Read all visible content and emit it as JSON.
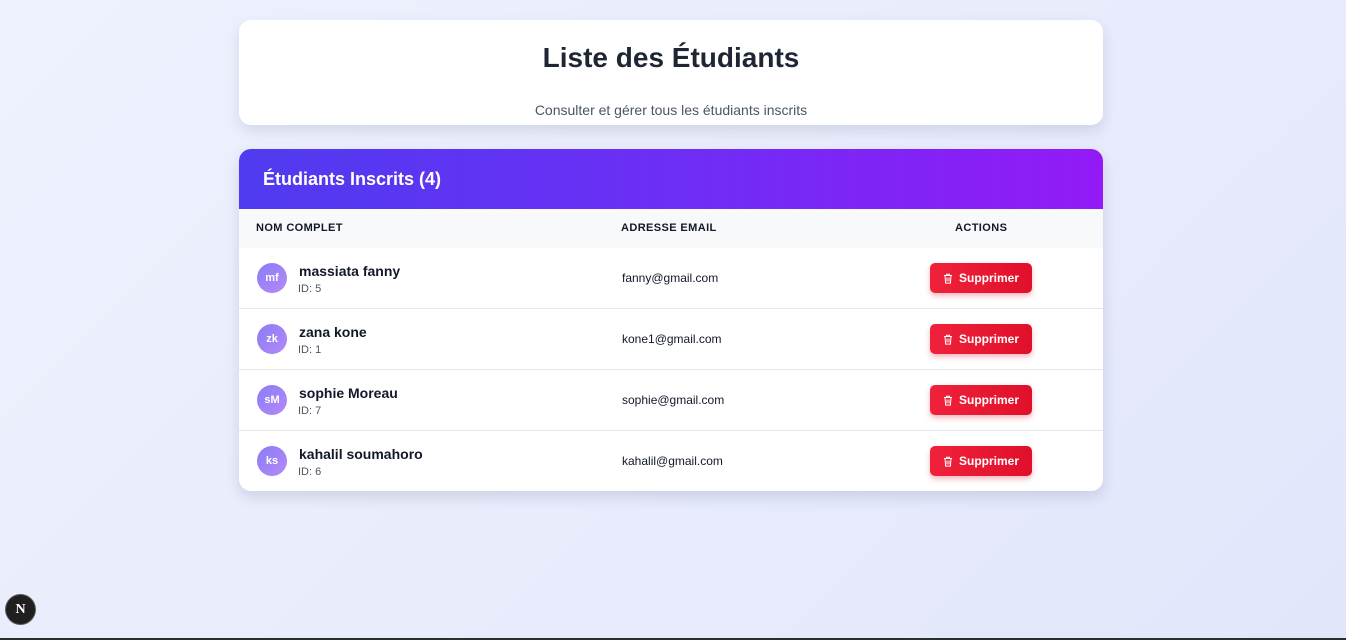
{
  "header": {
    "title": "Liste des Étudiants",
    "subtitle": "Consulter et gérer tous les étudiants inscrits"
  },
  "table": {
    "title": "Étudiants Inscrits (4)",
    "columns": {
      "name": "NOM COMPLET",
      "email": "ADRESSE EMAIL",
      "actions": "ACTIONS"
    },
    "rows": [
      {
        "initials": "mf",
        "name": "massiata fanny",
        "id": "ID: 5",
        "email": "fanny@gmail.com",
        "action": "Supprimer"
      },
      {
        "initials": "zk",
        "name": "zana kone",
        "id": "ID: 1",
        "email": "kone1@gmail.com",
        "action": "Supprimer"
      },
      {
        "initials": "sM",
        "name": "sophie Moreau",
        "id": "ID: 7",
        "email": "sophie@gmail.com",
        "action": "Supprimer"
      },
      {
        "initials": "ks",
        "name": "kahalil soumahoro",
        "id": "ID: 6",
        "email": "kahalil@gmail.com",
        "action": "Supprimer"
      }
    ]
  },
  "dev_badge": {
    "letter": "N",
    "icon": "nextjs-icon"
  },
  "colors": {
    "accent_start": "#4f3bf0",
    "accent_end": "#931af7",
    "danger": "#e81930",
    "avatar": "#9b83f7"
  },
  "icons": {
    "delete": "trash-icon"
  }
}
